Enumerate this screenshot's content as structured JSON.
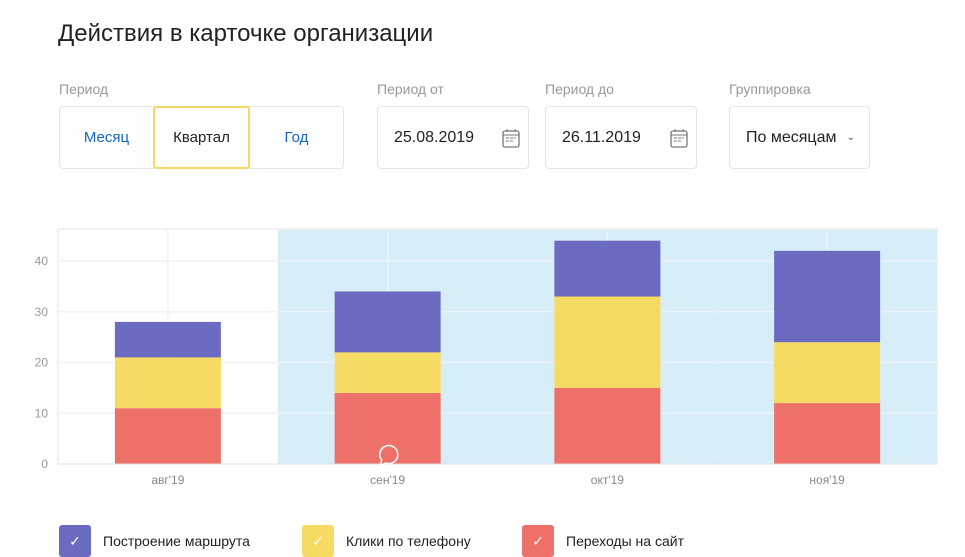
{
  "title": "Действия в карточке организации",
  "period": {
    "label": "Период",
    "options": [
      "Месяц",
      "Квартал",
      "Год"
    ],
    "selected": "Квартал"
  },
  "date_from": {
    "label": "Период от",
    "value": "25.08.2019"
  },
  "date_to": {
    "label": "Период до",
    "value": "26.11.2019"
  },
  "grouping": {
    "label": "Группировка",
    "value": "По месяцам"
  },
  "colors": {
    "route": "#6b6bc1",
    "calls": "#f7da63",
    "site": "#ed7069",
    "highlight": "#d7eef9"
  },
  "chart_data": {
    "type": "bar",
    "stacked": true,
    "categories": [
      "авг'19",
      "сен'19",
      "окт'19",
      "ноя'19"
    ],
    "series": [
      {
        "name": "Переходы на сайт",
        "color": "#ed7069",
        "values": [
          11,
          14,
          15,
          12
        ]
      },
      {
        "name": "Клики по телефону",
        "color": "#f7da63",
        "values": [
          10,
          8,
          18,
          12
        ]
      },
      {
        "name": "Построение маршрута",
        "color": "#6b6bc1",
        "values": [
          7,
          12,
          11,
          18
        ]
      }
    ],
    "yticks": [
      0,
      10,
      20,
      30,
      40
    ],
    "ylim": [
      0,
      46
    ],
    "highlighted_categories": [
      "сен'19",
      "окт'19",
      "ноя'19"
    ],
    "grid": true,
    "legend_placement": "bottom"
  },
  "legend": [
    {
      "label": "Построение маршрута",
      "color": "#6b6bc1"
    },
    {
      "label": "Клики по телефону",
      "color": "#f7da63"
    },
    {
      "label": "Переходы на сайт",
      "color": "#ed7069"
    }
  ]
}
